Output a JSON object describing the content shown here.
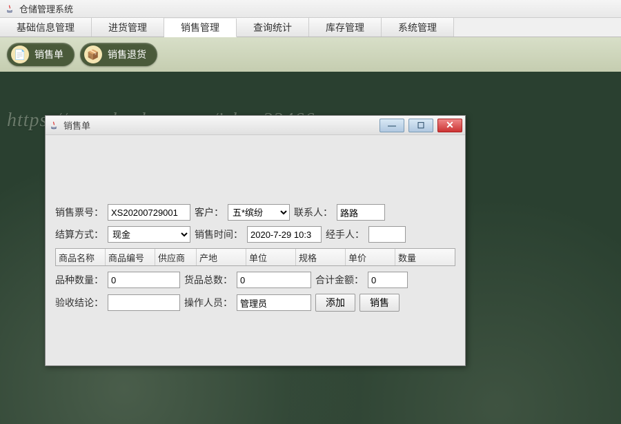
{
  "app": {
    "title": "仓储管理系统"
  },
  "tabs": [
    {
      "label": "基础信息管理"
    },
    {
      "label": "进货管理"
    },
    {
      "label": "销售管理"
    },
    {
      "label": "查询统计"
    },
    {
      "label": "库存管理"
    },
    {
      "label": "系统管理"
    }
  ],
  "toolbar": {
    "sales_order": "销售单",
    "sales_return": "销售退货"
  },
  "watermark_text": "https://www.huzhan.com/ishop33466",
  "dialog": {
    "title": "销售单",
    "labels": {
      "ticket_no": "销售票号：",
      "customer": "客户：",
      "contact": "联系人：",
      "settlement": "结算方式：",
      "sale_time": "销售时间：",
      "handler": "经手人：",
      "variety_count": "品种数量：",
      "goods_total": "货品总数：",
      "total_amount": "合计金额：",
      "inspect": "验收结论：",
      "operator": "操作人员："
    },
    "values": {
      "ticket_no": "XS20200729001",
      "customer": "五*缤纷",
      "contact": "路路",
      "settlement": "现金",
      "sale_time": "2020-7-29 10:3",
      "handler": "",
      "variety_count": "0",
      "goods_total": "0",
      "total_amount": "0",
      "inspect": "",
      "operator": "管理员"
    },
    "columns": [
      "商品名称",
      "商品编号",
      "供应商",
      "产地",
      "单位",
      "规格",
      "单价",
      "数量"
    ],
    "buttons": {
      "add": "添加",
      "sell": "销售"
    }
  }
}
